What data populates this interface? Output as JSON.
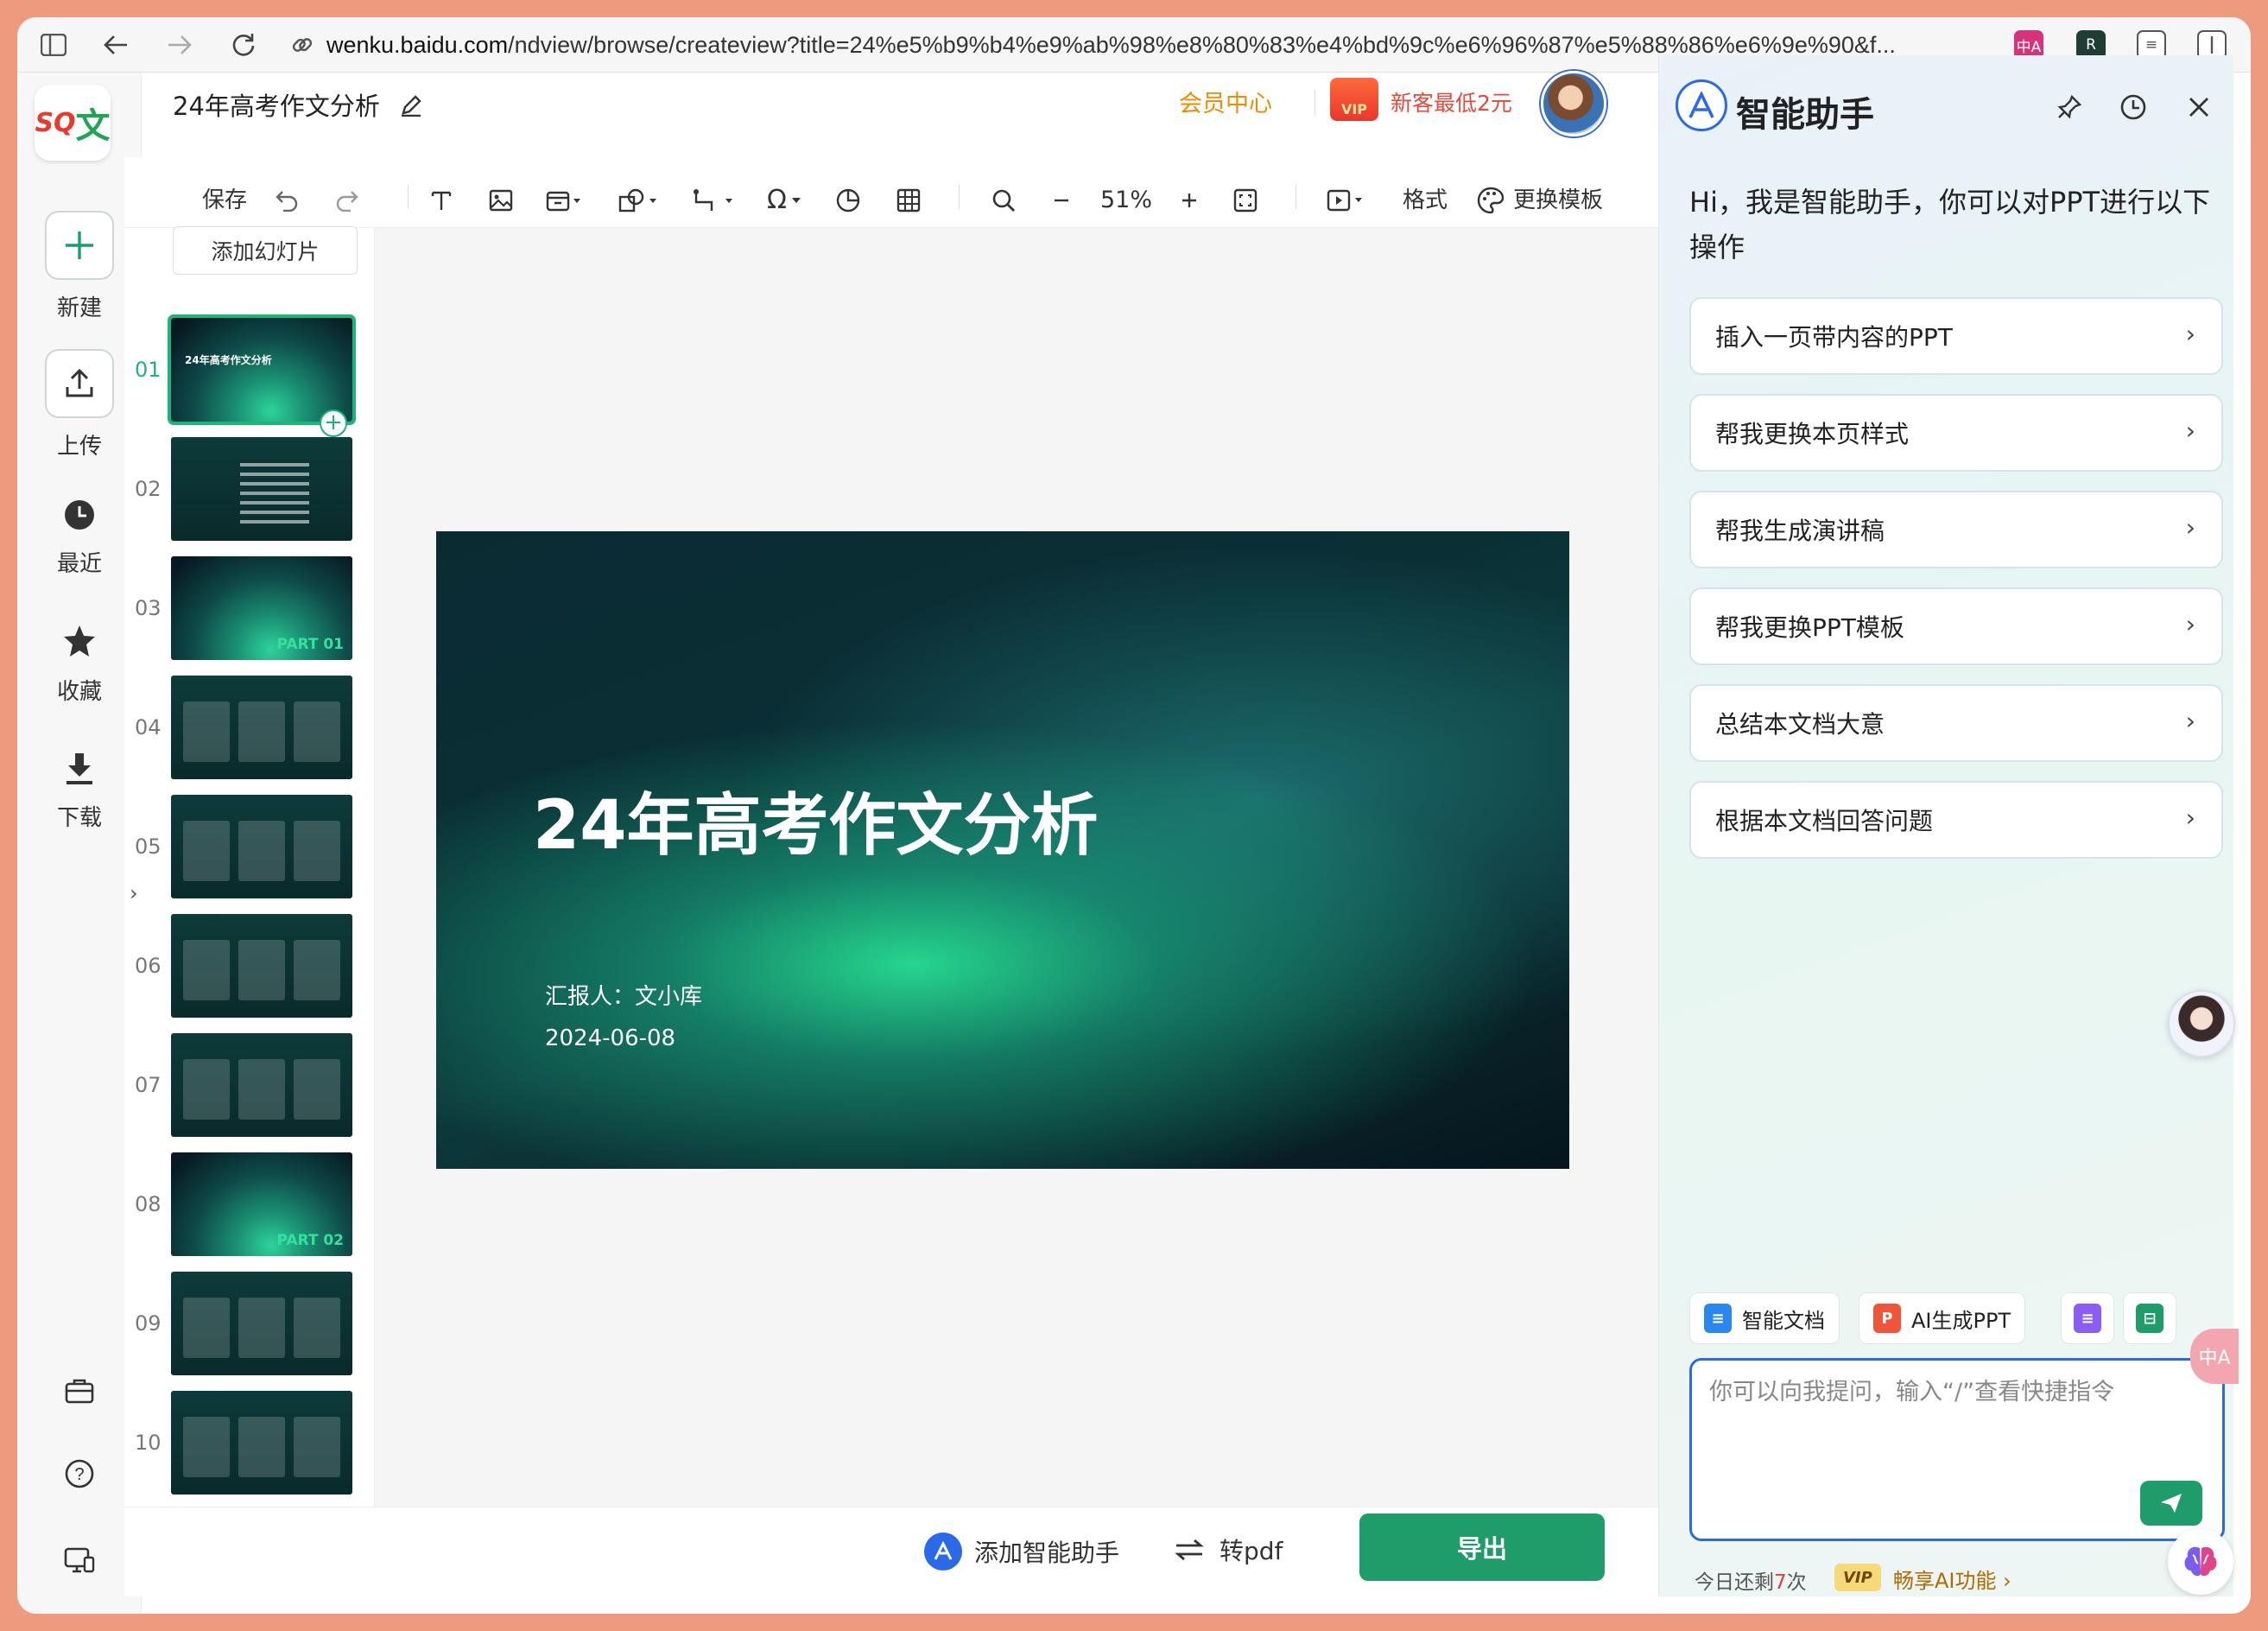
{
  "browser": {
    "url_host": "wenku.baidu.com",
    "url_path": "/ndview/browse/createview?title=24%e5%b9%b4%e9%ab%98%e8%80%83%e4%bd%9c%e6%96%87%e5%88%86%e6%9e%90&f..."
  },
  "rail": {
    "items": [
      {
        "label": "新建",
        "icon": "plus-icon"
      },
      {
        "label": "上传",
        "icon": "upload-icon"
      },
      {
        "label": "最近",
        "icon": "clock-icon"
      },
      {
        "label": "收藏",
        "icon": "star-icon"
      },
      {
        "label": "下载",
        "icon": "download-icon"
      }
    ]
  },
  "header": {
    "doc_title": "24年高考作文分析",
    "vip_center": "会员中心",
    "promo": "新客最低2元",
    "vip_gift_label": "VIP"
  },
  "toolbar": {
    "save": "保存",
    "zoom": "51%",
    "format": "格式",
    "change_template": "更换模板"
  },
  "slides": {
    "add_slide": "添加幻灯片",
    "items": [
      {
        "num": "01",
        "title": "24年高考作文分析"
      },
      {
        "num": "02",
        "title": ""
      },
      {
        "num": "03",
        "title": "",
        "part": "PART 01"
      },
      {
        "num": "04",
        "title": ""
      },
      {
        "num": "05",
        "title": ""
      },
      {
        "num": "06",
        "title": ""
      },
      {
        "num": "07",
        "title": ""
      },
      {
        "num": "08",
        "title": "",
        "part": "PART 02"
      },
      {
        "num": "09",
        "title": ""
      },
      {
        "num": "10",
        "title": ""
      }
    ]
  },
  "main_slide": {
    "title": "24年高考作文分析",
    "reporter": "汇报人：文小库",
    "date": "2024-06-08"
  },
  "bottom": {
    "add_assistant": "添加智能助手",
    "to_pdf": "转pdf",
    "export": "导出"
  },
  "assistant": {
    "title": "智能助手",
    "intro": "Hi，我是智能助手，你可以对PPT进行以下操作",
    "actions": [
      "插入一页带内容的PPT",
      "帮我更换本页样式",
      "帮我生成演讲稿",
      "帮我更换PPT模板",
      "总结本文档大意",
      "根据本文档回答问题"
    ],
    "chips": [
      "智能文档",
      "AI生成PPT"
    ],
    "input_placeholder": "你可以向我提问，输入“/”查看快捷指令",
    "quota_prefix": "今日还剩",
    "quota_count": "7",
    "quota_suffix": "次",
    "vip_badge": "VIP",
    "vip_text": "畅享AI功能 ›"
  },
  "colors": {
    "accent_green": "#1e9c6a",
    "assistant_blue": "#2a6ae8",
    "vip_orange": "#f08c00",
    "promo_red": "#e84a3a"
  }
}
